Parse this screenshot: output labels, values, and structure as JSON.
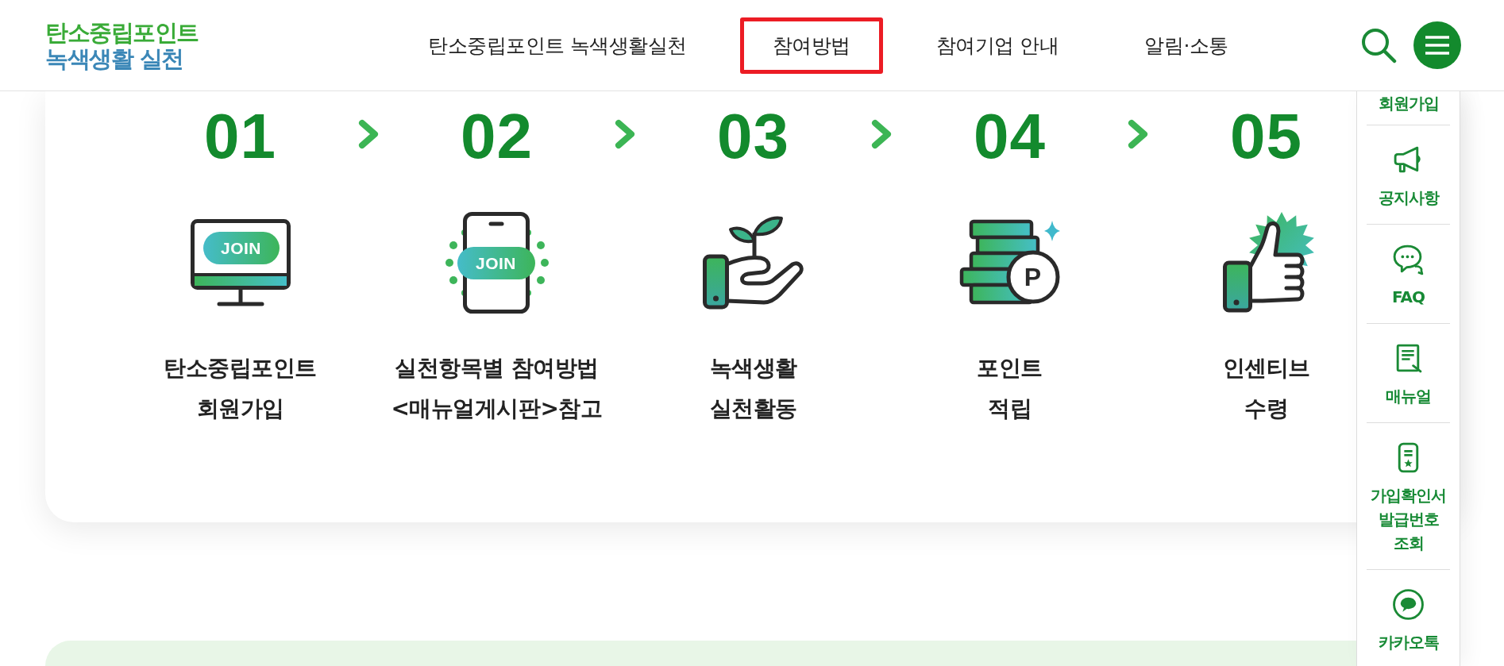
{
  "header": {
    "logo": {
      "lines": [
        "탄소중립포인트",
        "녹색생활 실천"
      ]
    },
    "nav": [
      {
        "label": "탄소중립포인트 녹색생활실천",
        "selected": false
      },
      {
        "label": "참여방법",
        "selected": true
      },
      {
        "label": "참여기업 안내",
        "selected": false
      },
      {
        "label": "알림·소통",
        "selected": false
      }
    ]
  },
  "steps": [
    {
      "number": "01",
      "badge": "JOIN",
      "label": [
        "탄소중립포인트",
        "회원가입"
      ]
    },
    {
      "number": "02",
      "badge": "JOIN",
      "label": [
        "실천항목별 참여방법",
        "<매뉴얼게시판>참고"
      ]
    },
    {
      "number": "03",
      "label": [
        "녹색생활",
        "실천활동"
      ]
    },
    {
      "number": "04",
      "badge": "P",
      "label": [
        "포인트",
        "적립"
      ]
    },
    {
      "number": "05",
      "label": [
        "인센티브",
        "수령"
      ]
    }
  ],
  "quick_menu": [
    {
      "label": [
        "회원가입"
      ]
    },
    {
      "label": [
        "공지사항"
      ]
    },
    {
      "label": [
        "FAQ"
      ]
    },
    {
      "label": [
        "매뉴얼"
      ]
    },
    {
      "label": [
        "가입확인서",
        "발급번호",
        "조회"
      ]
    },
    {
      "label": [
        "카카오톡"
      ]
    }
  ]
}
